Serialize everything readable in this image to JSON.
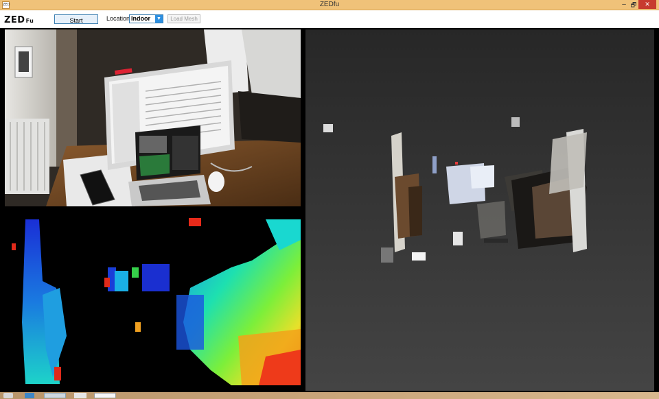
{
  "window": {
    "title": "ZEDfu",
    "app_icon": "ZED",
    "minimize_symbol": "–",
    "maximize_symbol": "🗗",
    "close_symbol": "✕"
  },
  "toolbar": {
    "logo_main": "ZED",
    "logo_sub": "Fu",
    "start_label": "Start",
    "location_label": "Location",
    "location_value": "Indoor",
    "load_mesh_label": "Load Mesh"
  },
  "panels": {
    "rgb": "left camera image",
    "depth": "depth map",
    "mesh": "3d mesh view"
  },
  "colors": {
    "accent": "#3c7fb1",
    "close": "#c73b2f",
    "titlebar": "#f0c279"
  },
  "icons": {
    "dropdown": "chevron-down-icon",
    "close": "close-icon",
    "minimize": "minimize-icon",
    "maximize": "restore-icon"
  }
}
